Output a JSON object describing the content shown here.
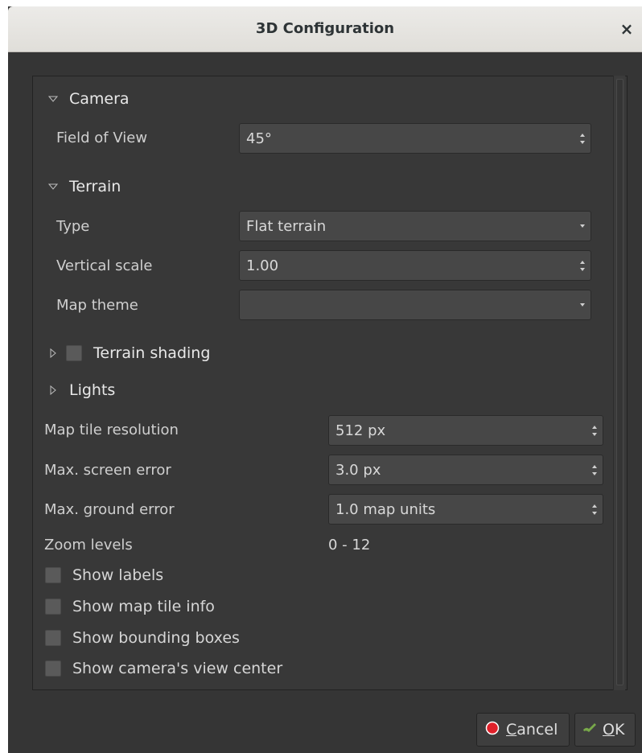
{
  "window": {
    "title": "3D Configuration",
    "close_glyph": "×"
  },
  "camera": {
    "header": "Camera",
    "fov_label": "Field of View",
    "fov_value": "45°"
  },
  "terrain": {
    "header": "Terrain",
    "type_label": "Type",
    "type_value": "Flat terrain",
    "vscale_label": "Vertical scale",
    "vscale_value": "1.00",
    "theme_label": "Map theme",
    "theme_value": ""
  },
  "shading": {
    "header": "Terrain shading",
    "checked": false
  },
  "lights": {
    "header": "Lights"
  },
  "settings": {
    "tile_res_label": "Map tile resolution",
    "tile_res_value": "512 px",
    "screen_err_label": "Max. screen error",
    "screen_err_value": "3.0 px",
    "ground_err_label": "Max. ground error",
    "ground_err_value": "1.0 map units",
    "zoom_label": "Zoom levels",
    "zoom_value": "0 - 12"
  },
  "checkboxes": [
    {
      "label": "Show labels",
      "checked": false
    },
    {
      "label": "Show map tile info",
      "checked": false
    },
    {
      "label": "Show bounding boxes",
      "checked": false
    },
    {
      "label": "Show camera's view center",
      "checked": false
    }
  ],
  "buttons": {
    "cancel_mnemonic": "C",
    "cancel_rest": "ancel",
    "ok_mnemonic": "O",
    "ok_rest": "K"
  },
  "colors": {
    "background": "#353535",
    "titlebar": "#e6e4e0",
    "field": "#474747",
    "cancel_icon": "#e0202a",
    "ok_icon": "#78a84a"
  },
  "icons": {
    "close": "close-icon",
    "expanded": "triangle-down-icon",
    "collapsed": "triangle-right-icon",
    "cancel": "cancel-icon",
    "ok": "ok-icon"
  }
}
